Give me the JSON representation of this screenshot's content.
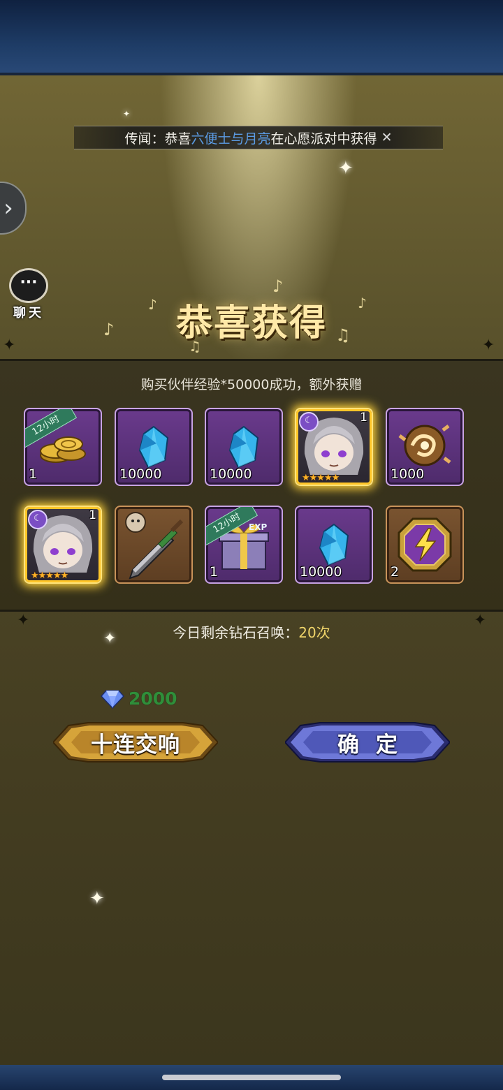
{
  "news": {
    "prefix": "传闻：恭喜",
    "player": "六便士与月亮",
    "suffix": "在心愿派对中获得"
  },
  "chat": {
    "label": "聊天"
  },
  "title": "恭喜获得",
  "purchase_text": "购买伙伴经验*50000成功，额外获赠",
  "items": [
    {
      "name": "gold-coins",
      "icon": "coin-stack-icon",
      "quantity": "1",
      "ribbon": "12小时"
    },
    {
      "name": "blue-crystal",
      "icon": "blue-crystal-icon",
      "quantity": "10000"
    },
    {
      "name": "blue-crystal",
      "icon": "blue-crystal-icon",
      "quantity": "10000"
    },
    {
      "name": "hero-card",
      "icon": "silver-hair-hero-portrait",
      "quantity": "1",
      "stars": "★★★★★"
    },
    {
      "name": "bronze-orb",
      "icon": "swirl-orb-icon",
      "quantity": "1000"
    },
    {
      "name": "hero-card",
      "icon": "silver-hair-hero-portrait",
      "quantity": "1",
      "stars": "★★★★★"
    },
    {
      "name": "sword",
      "icon": "sword-icon",
      "quantity": ""
    },
    {
      "name": "exp-gift-box",
      "icon": "gift-box-icon",
      "quantity": "1",
      "ribbon": "12小时"
    },
    {
      "name": "blue-crystal",
      "icon": "blue-crystal-icon",
      "quantity": "10000"
    },
    {
      "name": "lightning-token",
      "icon": "lightning-icon",
      "quantity": "2"
    }
  ],
  "summon": {
    "prefix": "今日剩余钻石召唤：",
    "count": "20次"
  },
  "cost": {
    "value": "2000",
    "icon": "diamond-icon"
  },
  "buttons": {
    "ten_pull": "十连交响",
    "confirm": "确定"
  },
  "colors": {
    "highlight_blue": "#5b9be3",
    "count_gold": "#f0d56a",
    "cost_green": "#2f8e3a",
    "glow_gold": "#ffd23a"
  }
}
